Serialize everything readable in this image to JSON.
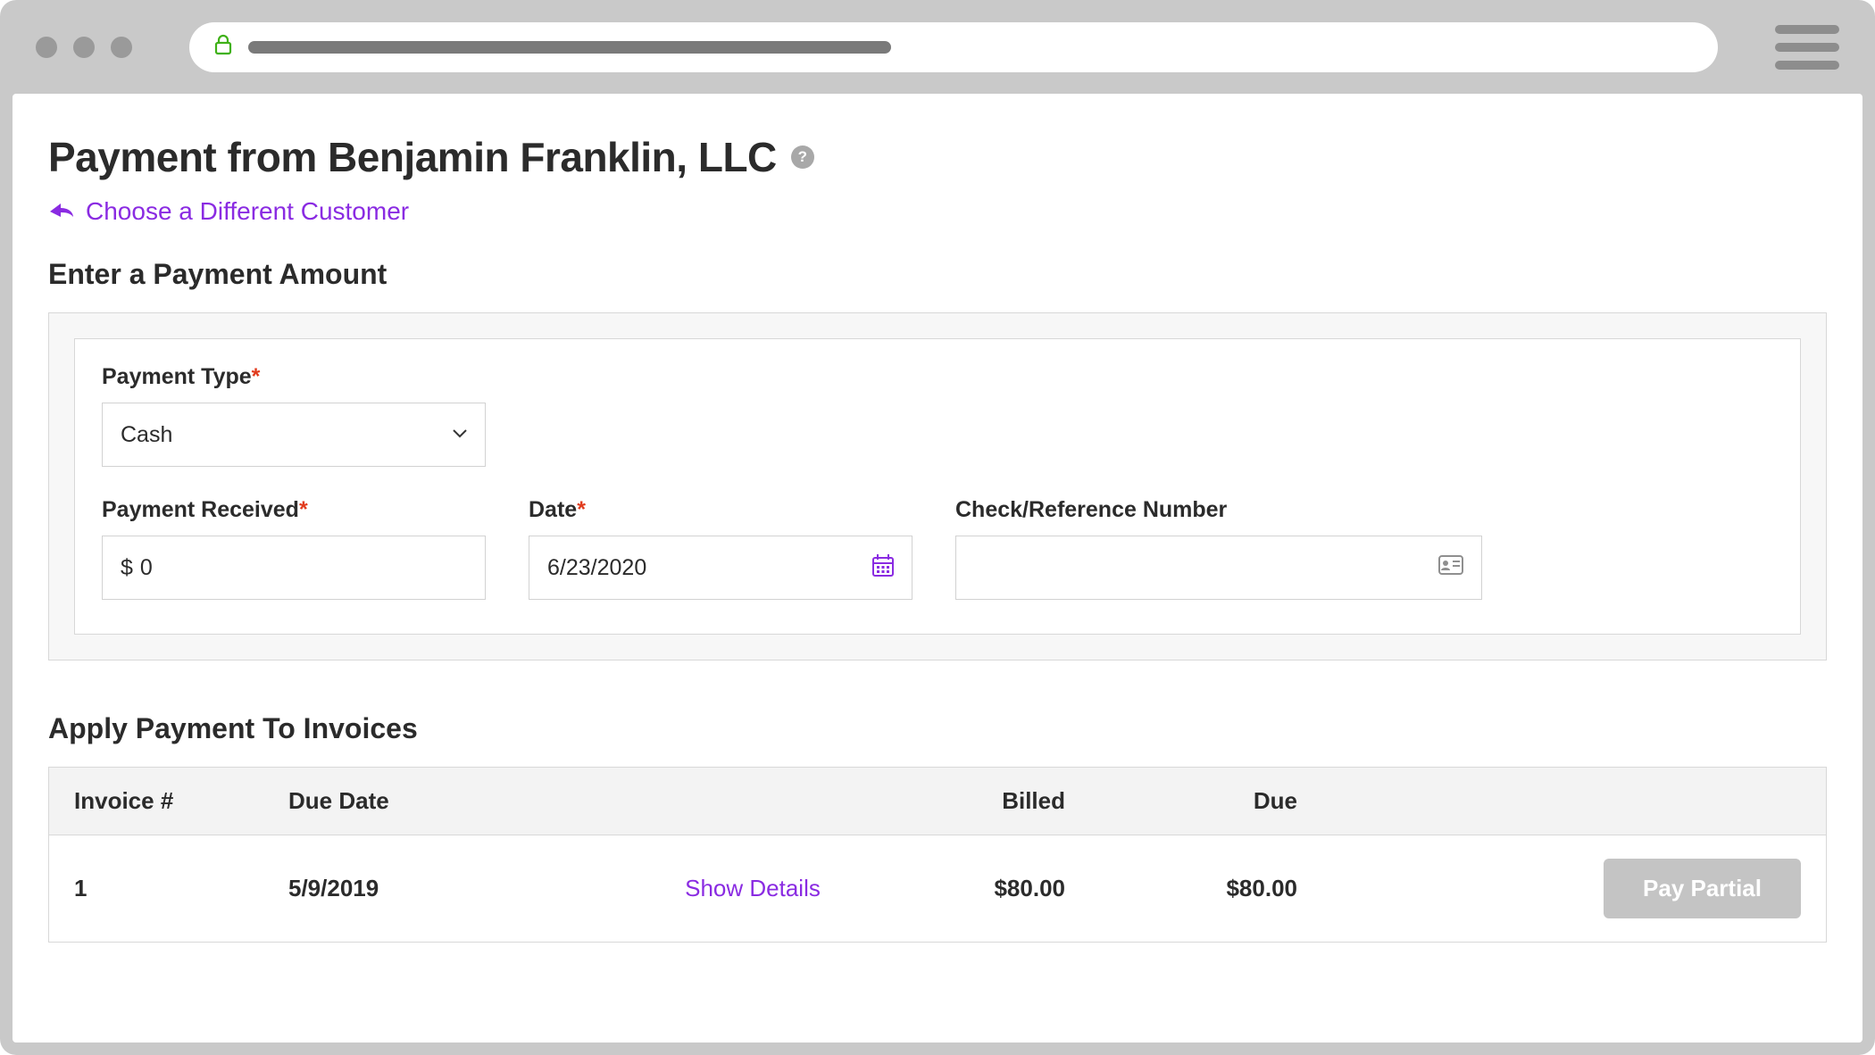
{
  "page": {
    "title": "Payment from Benjamin Franklin, LLC",
    "help_tooltip": "?",
    "back_link": "Choose a Different Customer",
    "section1_heading": "Enter a Payment Amount",
    "section2_heading": "Apply Payment To Invoices"
  },
  "form": {
    "payment_type": {
      "label": "Payment Type",
      "required": "*",
      "value": "Cash"
    },
    "payment_received": {
      "label": "Payment Received",
      "required": "*",
      "prefix": "$",
      "value": "0"
    },
    "date": {
      "label": "Date",
      "required": "*",
      "value": "6/23/2020"
    },
    "reference": {
      "label": "Check/Reference Number",
      "value": ""
    }
  },
  "invoice_table": {
    "headers": {
      "invoice_num": "Invoice #",
      "due_date": "Due Date",
      "details": "",
      "billed": "Billed",
      "due": "Due",
      "action": ""
    },
    "rows": [
      {
        "invoice_num": "1",
        "due_date": "5/9/2019",
        "details_link": "Show Details",
        "billed": "$80.00",
        "due": "$80.00",
        "action_label": "Pay Partial"
      }
    ]
  },
  "colors": {
    "accent": "#8a2be2",
    "required": "#e13b1d"
  }
}
